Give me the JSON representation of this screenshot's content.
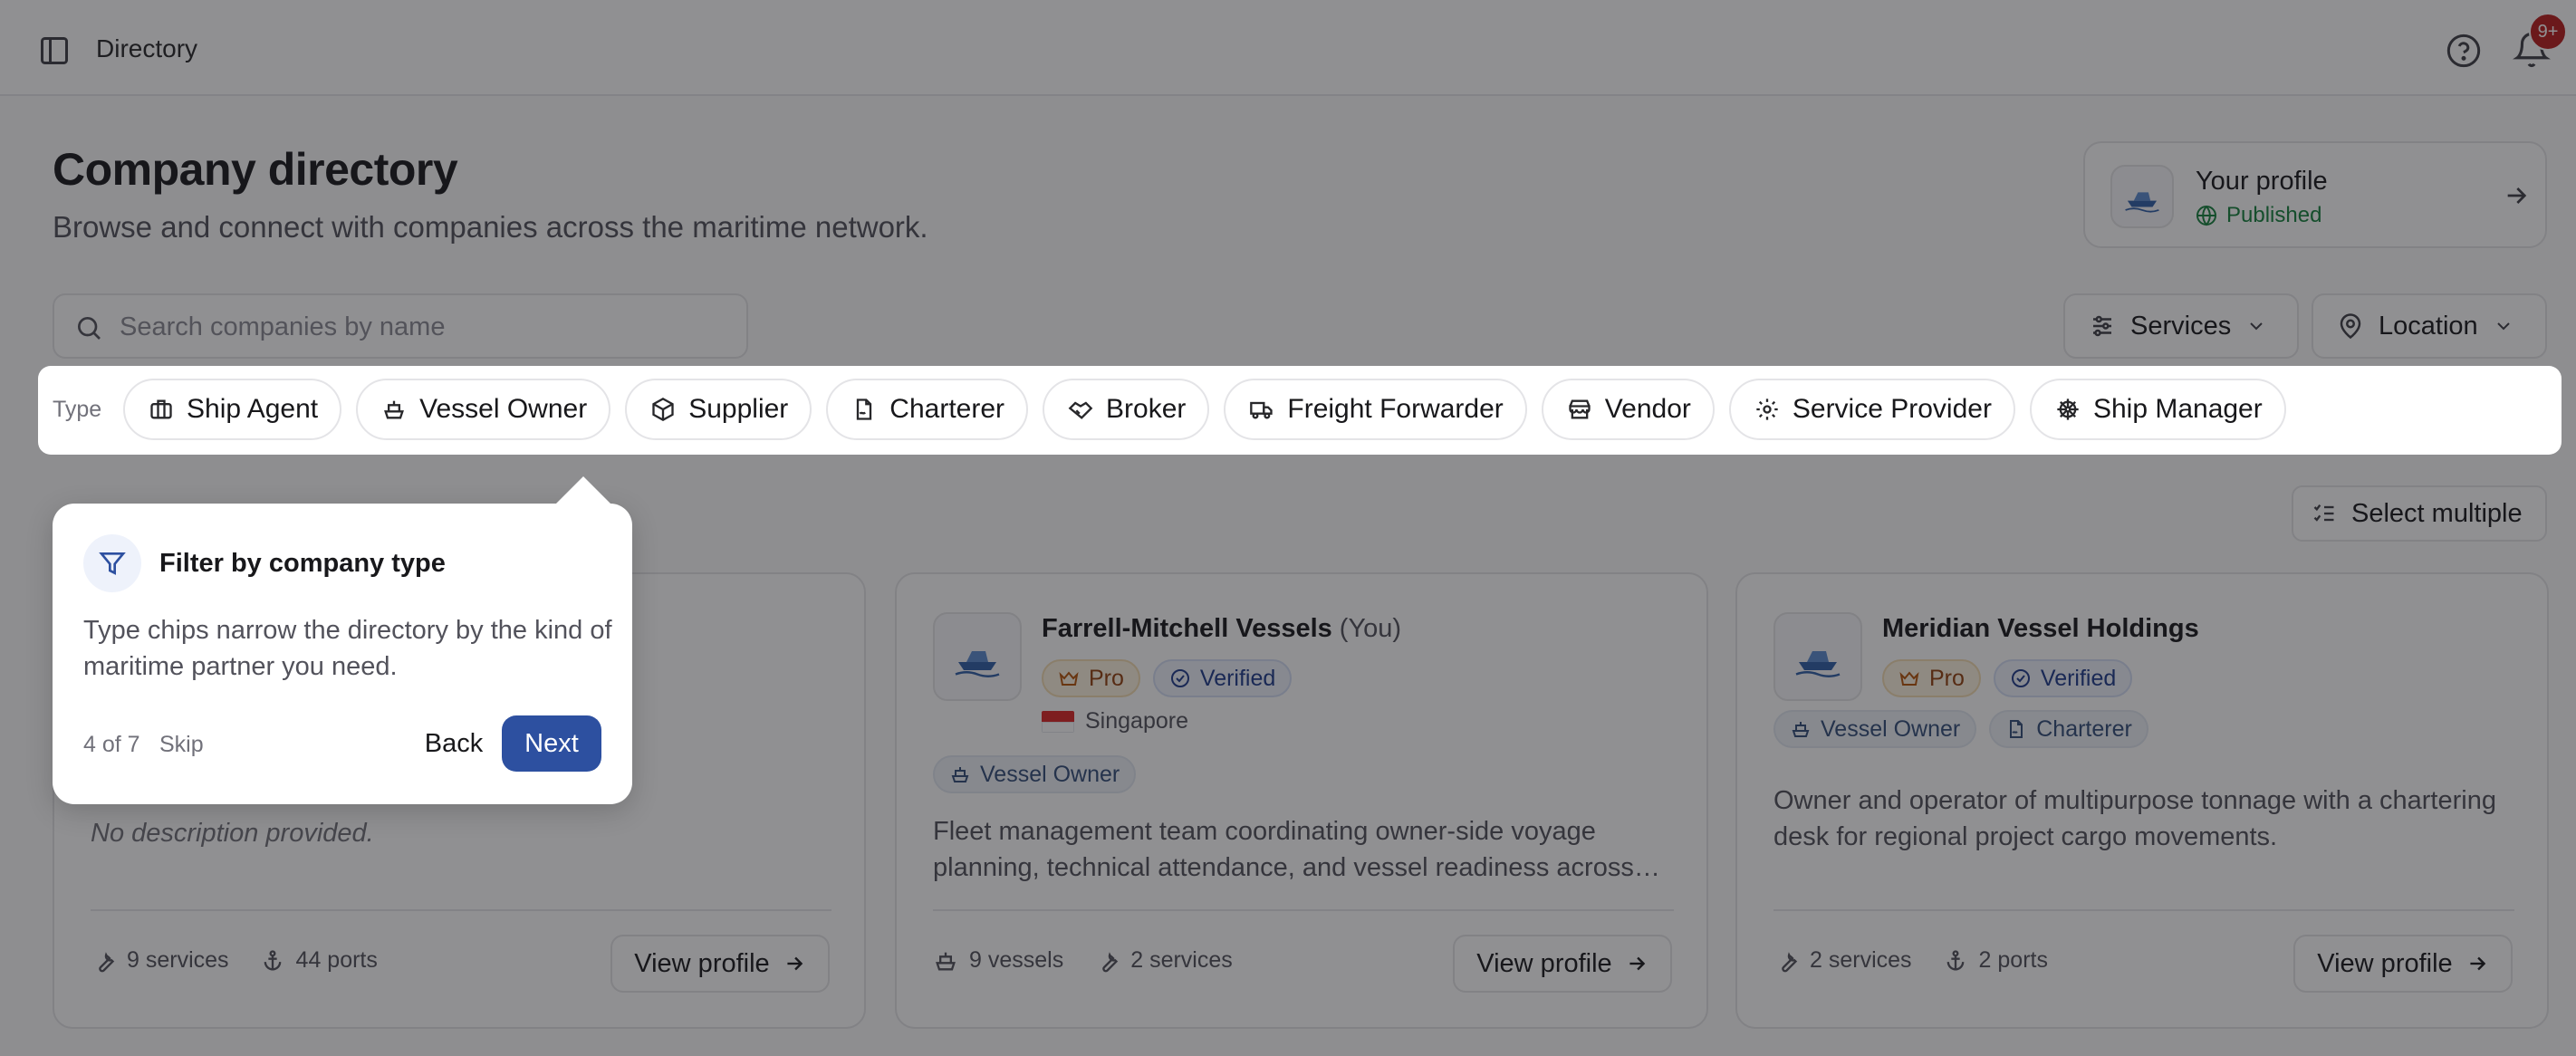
{
  "header": {
    "title": "Directory",
    "notification_count": "9+"
  },
  "page": {
    "title": "Company directory",
    "subtitle": "Browse and connect with companies across the maritime network."
  },
  "profile": {
    "name": "Your profile",
    "status": "Published"
  },
  "search": {
    "placeholder": "Search companies by name"
  },
  "filters": {
    "services": "Services",
    "location": "Location"
  },
  "type_filter": {
    "label": "Type",
    "chips": [
      {
        "label": "Ship Agent",
        "icon": "briefcase-icon"
      },
      {
        "label": "Vessel Owner",
        "icon": "ship-icon"
      },
      {
        "label": "Supplier",
        "icon": "package-icon"
      },
      {
        "label": "Charterer",
        "icon": "file-signature-icon"
      },
      {
        "label": "Broker",
        "icon": "handshake-icon"
      },
      {
        "label": "Freight Forwarder",
        "icon": "truck-icon"
      },
      {
        "label": "Vendor",
        "icon": "store-icon"
      },
      {
        "label": "Service Provider",
        "icon": "gear-icon"
      },
      {
        "label": "Ship Manager",
        "icon": "ship-wheel-icon"
      }
    ]
  },
  "select_multiple": "Select multiple",
  "cards": [
    {
      "description": "No description provided.",
      "stats": [
        {
          "label": "9 services",
          "icon": "wrench-icon"
        },
        {
          "label": "44 ports",
          "icon": "anchor-icon"
        }
      ],
      "view_label": "View profile"
    },
    {
      "name": "Farrell-Mitchell Vessels",
      "you_label": "(You)",
      "badges": [
        "Pro",
        "Verified"
      ],
      "location": "Singapore",
      "types": [
        "Vessel Owner"
      ],
      "description": "Fleet management team coordinating owner-side voyage planning, technical attendance, and vessel readiness across…",
      "stats": [
        {
          "label": "9 vessels",
          "icon": "ship-icon"
        },
        {
          "label": "2 services",
          "icon": "wrench-icon"
        }
      ],
      "view_label": "View profile"
    },
    {
      "name": "Meridian Vessel Holdings",
      "badges": [
        "Pro",
        "Verified"
      ],
      "types": [
        "Vessel Owner",
        "Charterer"
      ],
      "description": "Owner and operator of multipurpose tonnage with a chartering desk for regional project cargo movements.",
      "stats": [
        {
          "label": "2 services",
          "icon": "wrench-icon"
        },
        {
          "label": "2 ports",
          "icon": "anchor-icon"
        }
      ],
      "view_label": "View profile"
    }
  ],
  "tour": {
    "title": "Filter by company type",
    "body": "Type chips narrow the directory by the kind of maritime partner you need.",
    "step": "4 of 7",
    "skip": "Skip",
    "back": "Back",
    "next": "Next"
  },
  "colors": {
    "accent": "#2d50a0",
    "published": "#15803d",
    "badge": "#b91c1c"
  }
}
